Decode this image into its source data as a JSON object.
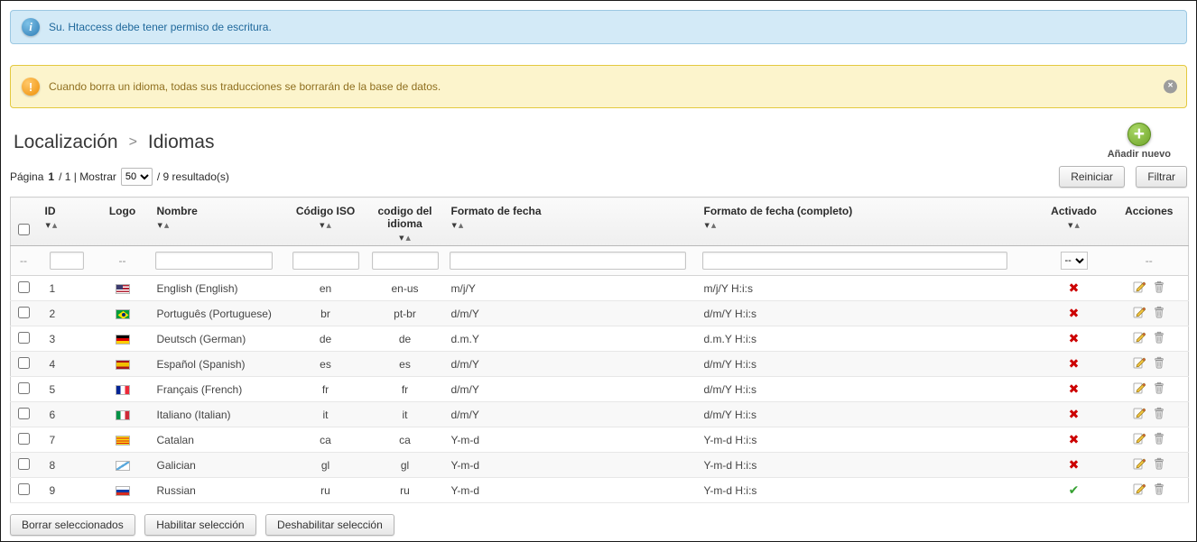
{
  "banners": {
    "info": {
      "text": "Su. Htaccess debe tener permiso de escritura."
    },
    "warning": {
      "text": "Cuando borra un idioma, todas sus traducciones se borrarán de la base de datos."
    }
  },
  "header": {
    "breadcrumb_parent": "Localización",
    "breadcrumb_separator": ">",
    "page_title": "Idiomas",
    "add_new_label": "Añadir nuevo"
  },
  "toolbar": {
    "page_label": "Página",
    "page_current": "1",
    "page_of": "/ 1 | Mostrar",
    "per_page": "50",
    "results": "/ 9 resultado(s)",
    "reset_button": "Reiniciar",
    "filter_button": "Filtrar"
  },
  "table": {
    "columns": [
      "ID",
      "Logo",
      "Nombre",
      "Código ISO",
      "codigo del idioma",
      "Formato de fecha",
      "Formato de fecha (completo)",
      "Activado",
      "Acciones"
    ],
    "filter": {
      "dash": "--",
      "active_option": "--",
      "id": "",
      "name": "",
      "iso": "",
      "language_code": "",
      "date_format": "",
      "date_format_full": ""
    },
    "rows": [
      {
        "id": "1",
        "flag": "flag-us",
        "name": "English (English)",
        "iso_code": "en",
        "language_code": "en-us",
        "date_format": "m/j/Y",
        "date_format_full": "m/j/Y H:i:s",
        "active": false
      },
      {
        "id": "2",
        "flag": "flag-br",
        "name": "Português (Portuguese)",
        "iso_code": "br",
        "language_code": "pt-br",
        "date_format": "d/m/Y",
        "date_format_full": "d/m/Y H:i:s",
        "active": false
      },
      {
        "id": "3",
        "flag": "flag-de",
        "name": "Deutsch (German)",
        "iso_code": "de",
        "language_code": "de",
        "date_format": "d.m.Y",
        "date_format_full": "d.m.Y H:i:s",
        "active": false
      },
      {
        "id": "4",
        "flag": "flag-es",
        "name": "Español (Spanish)",
        "iso_code": "es",
        "language_code": "es",
        "date_format": "d/m/Y",
        "date_format_full": "d/m/Y H:i:s",
        "active": false
      },
      {
        "id": "5",
        "flag": "flag-fr",
        "name": "Français (French)",
        "iso_code": "fr",
        "language_code": "fr",
        "date_format": "d/m/Y",
        "date_format_full": "d/m/Y H:i:s",
        "active": false
      },
      {
        "id": "6",
        "flag": "flag-it",
        "name": "Italiano (Italian)",
        "iso_code": "it",
        "language_code": "it",
        "date_format": "d/m/Y",
        "date_format_full": "d/m/Y H:i:s",
        "active": false
      },
      {
        "id": "7",
        "flag": "flag-ca",
        "name": "Catalan",
        "iso_code": "ca",
        "language_code": "ca",
        "date_format": "Y-m-d",
        "date_format_full": "Y-m-d H:i:s",
        "active": false
      },
      {
        "id": "8",
        "flag": "flag-gl",
        "name": "Galician",
        "iso_code": "gl",
        "language_code": "gl",
        "date_format": "Y-m-d",
        "date_format_full": "Y-m-d H:i:s",
        "active": false
      },
      {
        "id": "9",
        "flag": "flag-ru",
        "name": "Russian",
        "iso_code": "ru",
        "language_code": "ru",
        "date_format": "Y-m-d",
        "date_format_full": "Y-m-d H:i:s",
        "active": true
      }
    ]
  },
  "footer": {
    "buttons": [
      "Borrar seleccionados",
      "Habilitar selección",
      "Deshabilitar selección"
    ]
  },
  "colors": {
    "info_bg": "#d3eaf7",
    "warning_bg": "#fcf4cc",
    "active_green": "#36a132",
    "inactive_red": "#cc0000",
    "add_button_green": "#6fa42a"
  },
  "icons": {
    "info": "info-icon",
    "warning": "warning-icon",
    "close": "close-icon",
    "add_new": "plus-icon",
    "sort_desc": "sort-desc-icon",
    "sort_asc": "sort-asc-icon",
    "edit": "edit-pencil-icon",
    "delete": "trash-icon",
    "enabled": "green-check-icon",
    "disabled": "red-cross-icon"
  }
}
